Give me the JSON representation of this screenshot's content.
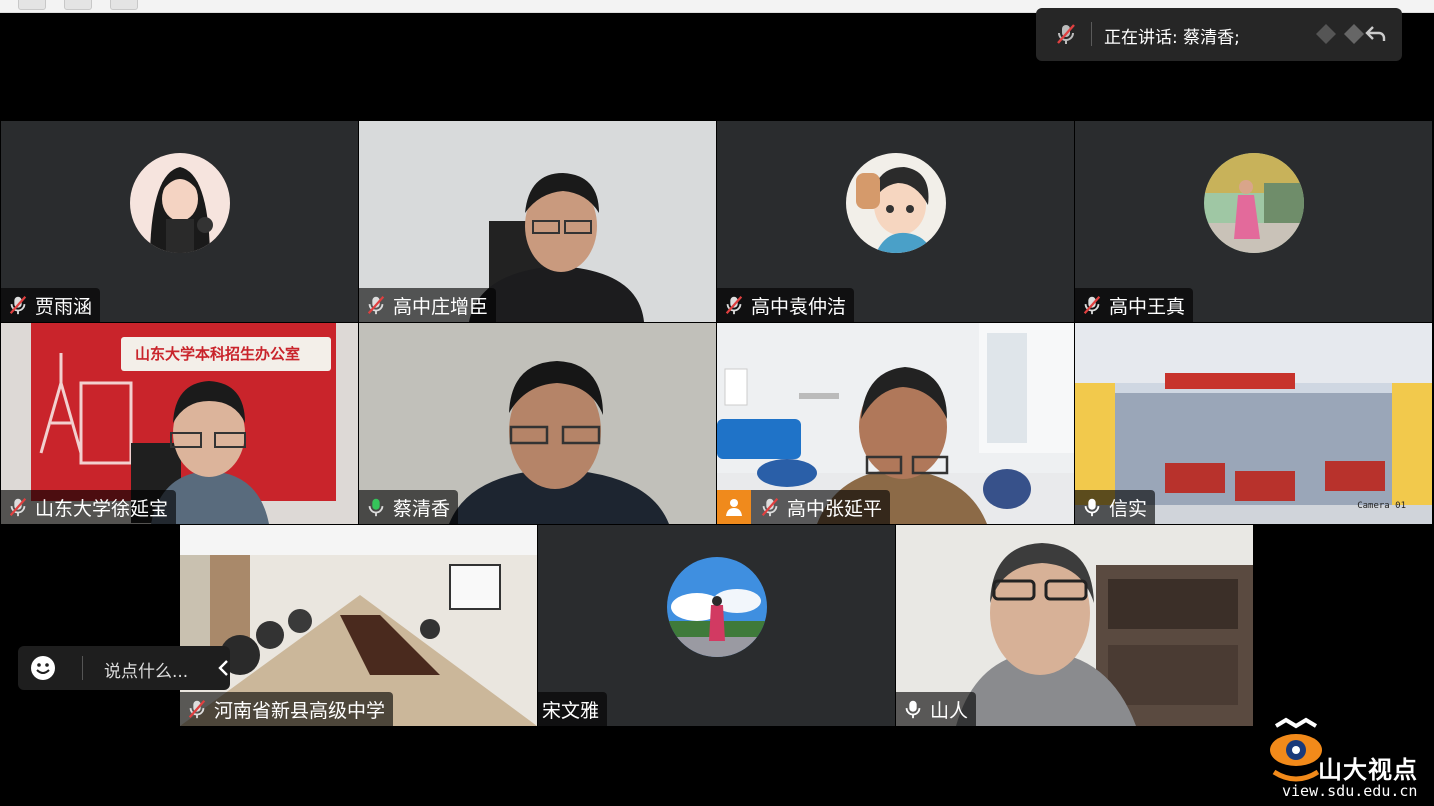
{
  "speaking_indicator": {
    "label": "正在讲话: 蔡清香;",
    "mic_icon": "mic-muted-icon"
  },
  "participants": [
    {
      "name": "贾雨涵",
      "audio": "muted",
      "video": false
    },
    {
      "name": "高中庄增臣",
      "audio": "muted",
      "video": true
    },
    {
      "name": "高中袁仲洁",
      "audio": "muted",
      "video": false
    },
    {
      "name": "高中王真",
      "audio": "muted",
      "video": false
    },
    {
      "name": "山东大学徐延宝",
      "audio": "muted",
      "video": true,
      "background_text": "山东大学本科招生办公室"
    },
    {
      "name": "蔡清香",
      "audio": "speaking",
      "video": true
    },
    {
      "name": "高中张延平",
      "audio": "muted",
      "video": true,
      "host_badge": "person-icon"
    },
    {
      "name": "信实",
      "audio": "on",
      "video": true,
      "background_text": "Camera 01"
    },
    {
      "name": "河南省新县高级中学",
      "audio": "muted",
      "video": true
    },
    {
      "name": "宋文雅",
      "audio": "none",
      "video": false
    },
    {
      "name": "山人",
      "audio": "on",
      "video": true
    }
  ],
  "chat": {
    "placeholder": "说点什么..."
  },
  "watermark": {
    "brand": "山大视点",
    "url": "view.sdu.edu.cn"
  },
  "colors": {
    "speaking_green": "#35c45a",
    "muted_red": "#e04040",
    "tile_bg": "#2a2c2e",
    "badge_orange": "#f08a1c"
  }
}
